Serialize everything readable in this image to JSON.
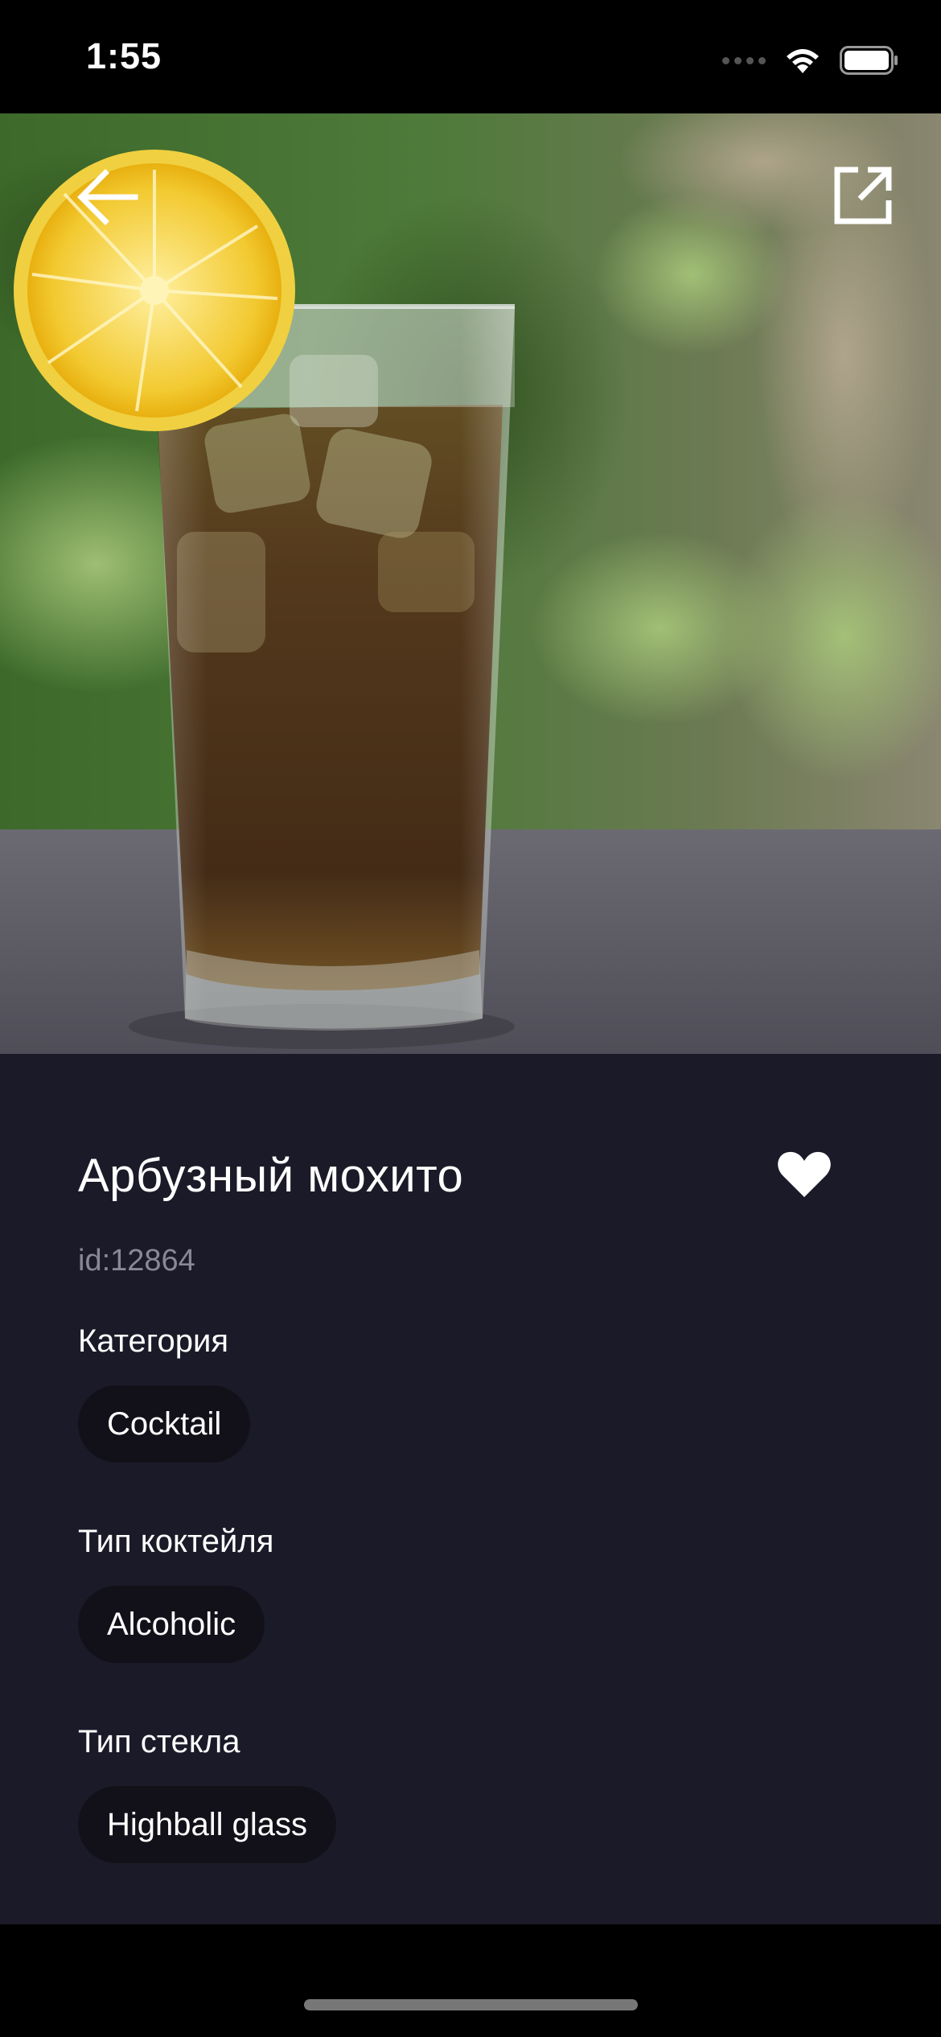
{
  "status_bar": {
    "time": "1:55"
  },
  "hero": {
    "image_alt": "",
    "back_icon": "arrow-left-icon",
    "open_icon": "open-external-icon"
  },
  "details": {
    "title": "Арбузный мохито",
    "id_text": "id:12864",
    "favorite_icon": "heart-icon",
    "sections": [
      {
        "label": "Категория",
        "value": "Cocktail"
      },
      {
        "label": "Тип коктейля",
        "value": "Alcoholic"
      },
      {
        "label": "Тип стекла",
        "value": "Highball glass"
      }
    ]
  },
  "colors": {
    "panel_bg": "#1b1a28",
    "chip_bg": "#121119",
    "muted_text": "#8a8898"
  }
}
